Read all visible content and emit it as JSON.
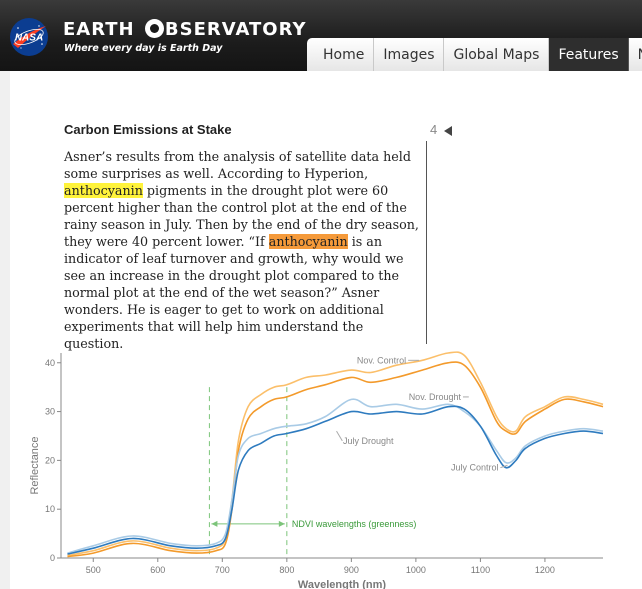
{
  "header": {
    "logo_text": "NASA",
    "brand_left": "EARTH",
    "brand_right": "BSERVATORY",
    "tagline": "Where every day is Earth Day",
    "nav": [
      "Home",
      "Images",
      "Global Maps",
      "Features",
      "Ne"
    ],
    "active_nav": "Features"
  },
  "article": {
    "title": "Carbon Emissions at Stake",
    "page": "4",
    "p1": "Asner’s results from the analysis of satellite data held some surprises as well. According to Hyperion, ",
    "hl1": "anthocyanin",
    "p2": " pigments in the drought plot were 60 percent higher than the control plot at the end of the rainy season in July. Then by the end of the dry season, they were 40 percent lower. “If ",
    "hl2": "anthocyanin",
    "p3": " is an indicator of leaf turnover and growth, why would we see an increase in the drought plot compared to the normal plot at the end of the wet season?” Asner wonders. He is eager to get to work on additional experiments that will help him understand the question."
  },
  "colors": {
    "highlight_1": "#fff33b",
    "highlight_2": "#f59a3a"
  },
  "chart_data": {
    "type": "line",
    "xlabel": "Wavelength (nm)",
    "ylabel": "Reflectance",
    "xlim": [
      450,
      1290
    ],
    "ylim": [
      0,
      42
    ],
    "x_ticks": [
      500,
      600,
      700,
      800,
      900,
      1000,
      1100,
      1200
    ],
    "y_ticks": [
      0,
      10,
      20,
      30,
      40
    ],
    "grid": false,
    "annotation": "NDVI wavelengths (greenness)",
    "ndvi_range": [
      680,
      800
    ],
    "series": [
      {
        "name": "Nov. Control",
        "color": "#fbbf6a",
        "x": [
          460,
          500,
          560,
          620,
          660,
          690,
          705,
          715,
          725,
          740,
          760,
          780,
          800,
          830,
          860,
          900,
          930,
          970,
          1010,
          1050,
          1075,
          1100,
          1125,
          1140,
          1155,
          1170,
          1200,
          1230,
          1260,
          1290
        ],
        "y": [
          0.5,
          1.5,
          3.5,
          2.0,
          1.5,
          2.0,
          4.0,
          12.0,
          24.0,
          31.0,
          33.5,
          35.0,
          35.5,
          37.0,
          37.5,
          38.5,
          38.0,
          39.5,
          40.5,
          42.0,
          41.5,
          36.0,
          29.0,
          26.5,
          26.0,
          29.0,
          31.0,
          33.0,
          32.5,
          31.5
        ]
      },
      {
        "name": "Nov. Drought",
        "color": "#f39a2b",
        "x": [
          460,
          500,
          560,
          620,
          660,
          690,
          705,
          715,
          725,
          740,
          760,
          780,
          800,
          830,
          860,
          900,
          930,
          970,
          1010,
          1050,
          1075,
          1100,
          1125,
          1140,
          1155,
          1170,
          1200,
          1230,
          1260,
          1290
        ],
        "y": [
          0.3,
          1.0,
          3.0,
          1.5,
          1.0,
          1.5,
          3.0,
          10.0,
          22.0,
          28.5,
          31.0,
          32.5,
          33.0,
          34.5,
          35.5,
          37.0,
          36.0,
          37.0,
          38.5,
          40.0,
          39.5,
          35.0,
          28.0,
          26.0,
          25.5,
          28.0,
          30.5,
          32.5,
          32.0,
          31.0
        ]
      },
      {
        "name": "July Drought",
        "color": "#a9cbe6",
        "x": [
          460,
          500,
          560,
          620,
          660,
          690,
          705,
          715,
          725,
          740,
          760,
          780,
          800,
          830,
          860,
          900,
          930,
          970,
          1010,
          1050,
          1075,
          1100,
          1125,
          1140,
          1155,
          1170,
          1200,
          1230,
          1260,
          1290
        ],
        "y": [
          1.0,
          2.5,
          4.5,
          3.0,
          2.5,
          3.0,
          5.0,
          12.0,
          21.0,
          24.5,
          25.5,
          26.5,
          27.0,
          27.5,
          29.0,
          32.5,
          31.0,
          31.5,
          30.5,
          31.5,
          30.0,
          27.0,
          22.0,
          19.5,
          20.5,
          23.0,
          25.0,
          26.0,
          26.5,
          26.0
        ]
      },
      {
        "name": "July Control",
        "color": "#2e7bbf",
        "x": [
          460,
          500,
          560,
          620,
          660,
          690,
          705,
          715,
          725,
          740,
          760,
          780,
          800,
          830,
          860,
          900,
          930,
          970,
          1010,
          1050,
          1075,
          1100,
          1125,
          1140,
          1155,
          1170,
          1200,
          1230,
          1260,
          1290
        ],
        "y": [
          0.8,
          2.0,
          4.0,
          2.5,
          2.0,
          2.5,
          4.0,
          10.0,
          18.0,
          22.0,
          23.5,
          25.0,
          25.5,
          26.5,
          28.0,
          30.0,
          29.5,
          30.0,
          29.5,
          31.0,
          30.5,
          27.0,
          21.0,
          18.5,
          20.0,
          22.5,
          24.5,
          25.5,
          26.0,
          25.5
        ]
      }
    ]
  }
}
